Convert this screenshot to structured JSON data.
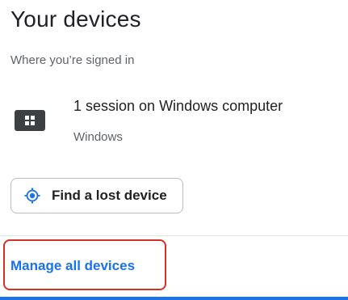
{
  "card": {
    "title": "Your devices",
    "subtitle": "Where you’re signed in"
  },
  "devices": [
    {
      "name": "1 session on Windows computer",
      "os": "Windows",
      "icon": "windows-computer-icon"
    }
  ],
  "actions": {
    "find_lost_device_label": "Find a lost device",
    "find_lost_device_icon": "location-target-icon",
    "manage_all_devices_label": "Manage all devices"
  },
  "colors": {
    "accent": "#1a73e8",
    "highlight": "#d93025",
    "text_primary": "#202124",
    "text_secondary": "#5f6368"
  }
}
